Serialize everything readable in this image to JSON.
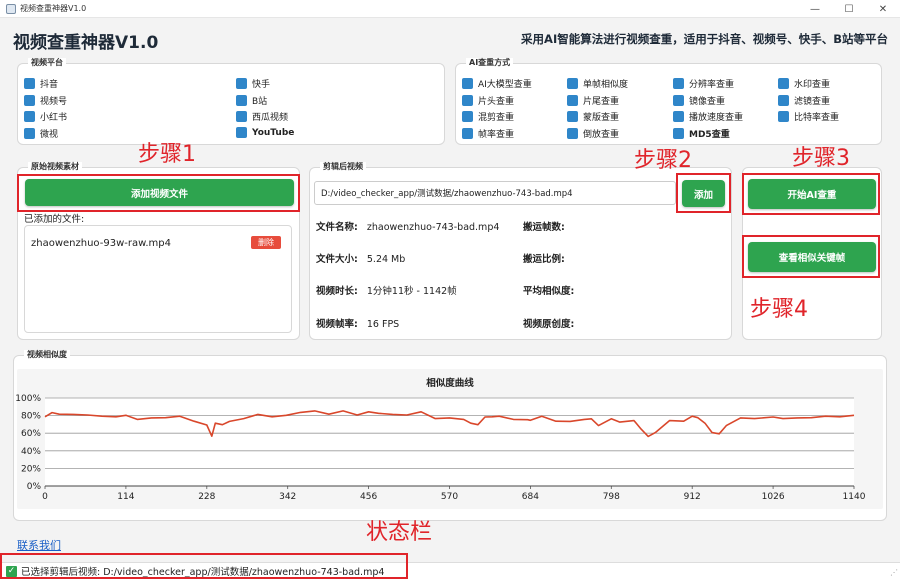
{
  "window": {
    "title": "视频查重神器V1.0",
    "controls": [
      "—",
      "☐",
      "✕"
    ]
  },
  "app_title": "视频查重神器V1.0",
  "app_subtitle": "采用AI智能算法进行视频查重，适用于抖音、视频号、快手、B站等平台",
  "platform_group": {
    "title": "视频平台",
    "items": [
      "抖音",
      "快手",
      "视频号",
      "B站",
      "小红书",
      "西瓜视频",
      "微视",
      "YouTube"
    ]
  },
  "ai_group": {
    "title": "AI查重方式",
    "items": [
      "AI大模型查重",
      "单帧相似度",
      "分辨率查重",
      "水印查重",
      "片头查重",
      "片尾查重",
      "镜像查重",
      "滤镜查重",
      "混剪查重",
      "蒙版查重",
      "播放速度查重",
      "比特率查重",
      "帧率查重",
      "倒放查重",
      "MD5查重"
    ]
  },
  "original_group": {
    "title": "原始视频素材",
    "add_button": "添加视频文件",
    "added_label": "已添加的文件:",
    "file_name": "zhaowenzhuo-93w-raw.mp4",
    "delete_button": "删除"
  },
  "edited_group": {
    "title": "剪辑后视频",
    "path_value": "D:/video_checker_app/测试数据/zhaowenzhuo-743-bad.mp4",
    "add_button": "添加",
    "info": {
      "file_name_label": "文件名称:",
      "file_name": "zhaowenzhuo-743-bad.mp4",
      "file_size_label": "文件大小:",
      "file_size": "5.24 Mb",
      "duration_label": "视频时长:",
      "duration": "1分钟11秒 - 1142帧",
      "fps_label": "视频帧率:",
      "fps": "16 FPS",
      "moved_frames_label": "搬运帧数:",
      "moved_ratio_label": "搬运比例:",
      "avg_similarity_label": "平均相似度:",
      "originality_label": "视频原创度:"
    }
  },
  "actions": {
    "start_button": "开始AI查重",
    "keyframes_button": "查看相似关键帧"
  },
  "annotations": {
    "step1": "步骤1",
    "step2": "步骤2",
    "step3": "步骤3",
    "step4": "步骤4",
    "status_bar": "状态栏"
  },
  "similarity_group": {
    "title": "视频相似度"
  },
  "contact_link": "联系我们",
  "status_text": "已选择剪辑后视频: D:/video_checker_app/测试数据/zhaowenzhuo-743-bad.mp4",
  "colors": {
    "accent_green": "#2ea44f",
    "checkbox_blue": "#2f86c9",
    "annotation_red": "#e0242a",
    "curve_red": "#d9472b"
  },
  "chart_data": {
    "type": "line",
    "title": "相似度曲线",
    "xlabel": "",
    "ylabel": "",
    "xlim": [
      0,
      1140
    ],
    "ylim": [
      0,
      100
    ],
    "x_ticks": [
      0,
      114,
      228,
      342,
      456,
      570,
      684,
      798,
      912,
      1026,
      1140
    ],
    "y_ticks": [
      "0%",
      "20%",
      "40%",
      "60%",
      "80%",
      "100%"
    ],
    "grid": true,
    "series": [
      {
        "x": [
          0,
          10,
          20,
          40,
          60,
          80,
          100,
          114,
          130,
          150,
          170,
          190,
          210,
          228,
          235,
          240,
          250,
          260,
          280,
          300,
          320,
          340,
          360,
          380,
          400,
          420,
          440,
          456,
          470,
          490,
          510,
          530,
          550,
          570,
          590,
          600,
          610,
          620,
          630,
          640,
          660,
          680,
          684,
          700,
          720,
          740,
          760,
          770,
          780,
          798,
          810,
          830,
          840,
          850,
          860,
          880,
          900,
          912,
          920,
          930,
          940,
          950,
          960,
          980,
          1000,
          1026,
          1040,
          1060,
          1080,
          1100,
          1120,
          1140
        ],
        "values": [
          80,
          82,
          83,
          80,
          82,
          78,
          80,
          79,
          77,
          76,
          79,
          78,
          75,
          68,
          58,
          70,
          71,
          72,
          78,
          80,
          80,
          79,
          85,
          84,
          83,
          84,
          82,
          83,
          84,
          80,
          82,
          83,
          78,
          76,
          77,
          70,
          71,
          77,
          80,
          78,
          77,
          74,
          76,
          78,
          75,
          72,
          77,
          75,
          70,
          75,
          74,
          73,
          66,
          55,
          62,
          73,
          75,
          78,
          79,
          70,
          62,
          58,
          70,
          76,
          78,
          77,
          78,
          76,
          79,
          78,
          80,
          79
        ]
      }
    ]
  }
}
